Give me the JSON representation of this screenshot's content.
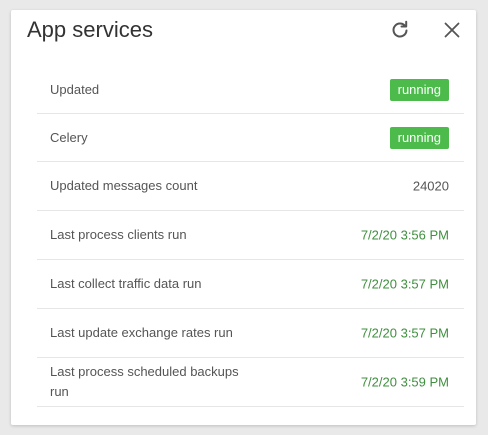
{
  "title": "App services",
  "colors": {
    "badge_running": "#4cbb4c",
    "date_text": "#3f8f3f"
  },
  "icons": {
    "refresh": "refresh-icon",
    "close": "close-icon"
  },
  "rows": [
    {
      "label": "Updated",
      "value": "running",
      "type": "badge"
    },
    {
      "label": "Celery",
      "value": "running",
      "type": "badge"
    },
    {
      "label": "Updated messages count",
      "value": "24020",
      "type": "text"
    },
    {
      "label": "Last process clients run",
      "value": "7/2/20 3:56 PM",
      "type": "date"
    },
    {
      "label": "Last collect traffic data run",
      "value": "7/2/20 3:57 PM",
      "type": "date"
    },
    {
      "label": "Last update exchange rates run",
      "value": "7/2/20 3:57 PM",
      "type": "date"
    },
    {
      "label": "Last process scheduled backups run",
      "value": "7/2/20 3:59 PM",
      "type": "date"
    }
  ]
}
